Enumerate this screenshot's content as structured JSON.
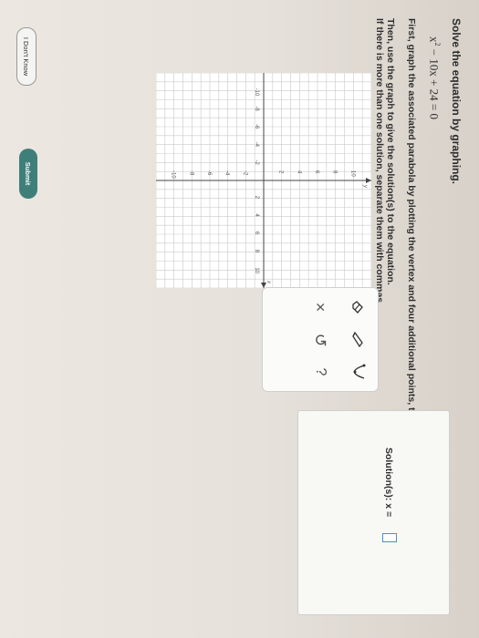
{
  "problem": {
    "title": "Solve the equation by graphing.",
    "equation_lhs": "x",
    "equation_exp": "2",
    "equation_rest": " − 10x + 24 = 0",
    "instruction_1": "First, graph the associated parabola by plotting the vertex and four additional points, two on each side of the vertex.",
    "instruction_2": "Then, use the graph to give the solution(s) to the equation.",
    "instruction_3": "If there is more than one solution, separate them with commas."
  },
  "graph": {
    "x_label": "x",
    "y_label": "y",
    "x_ticks": [
      "-10",
      "-8",
      "-6",
      "-4",
      "-2",
      "2",
      "4",
      "6",
      "8",
      "10"
    ],
    "y_ticks": [
      "10",
      "8",
      "6",
      "4",
      "2",
      "-2",
      "-4",
      "-6",
      "-8",
      "-10"
    ]
  },
  "toolbox": {
    "icons": [
      "eraser-icon",
      "point-icon",
      "parabola-icon",
      "clear-icon",
      "undo-icon",
      "help-icon"
    ],
    "clear_symbol": "×",
    "undo_symbol": "↺",
    "help_symbol": "?"
  },
  "solution": {
    "label": "Solution(s): x ="
  },
  "buttons": {
    "dont_know": "I Don't Know",
    "submit": "Submit"
  },
  "colors": {
    "submit_bg": "#3f7f7a",
    "input_border": "#4a8fd8"
  }
}
